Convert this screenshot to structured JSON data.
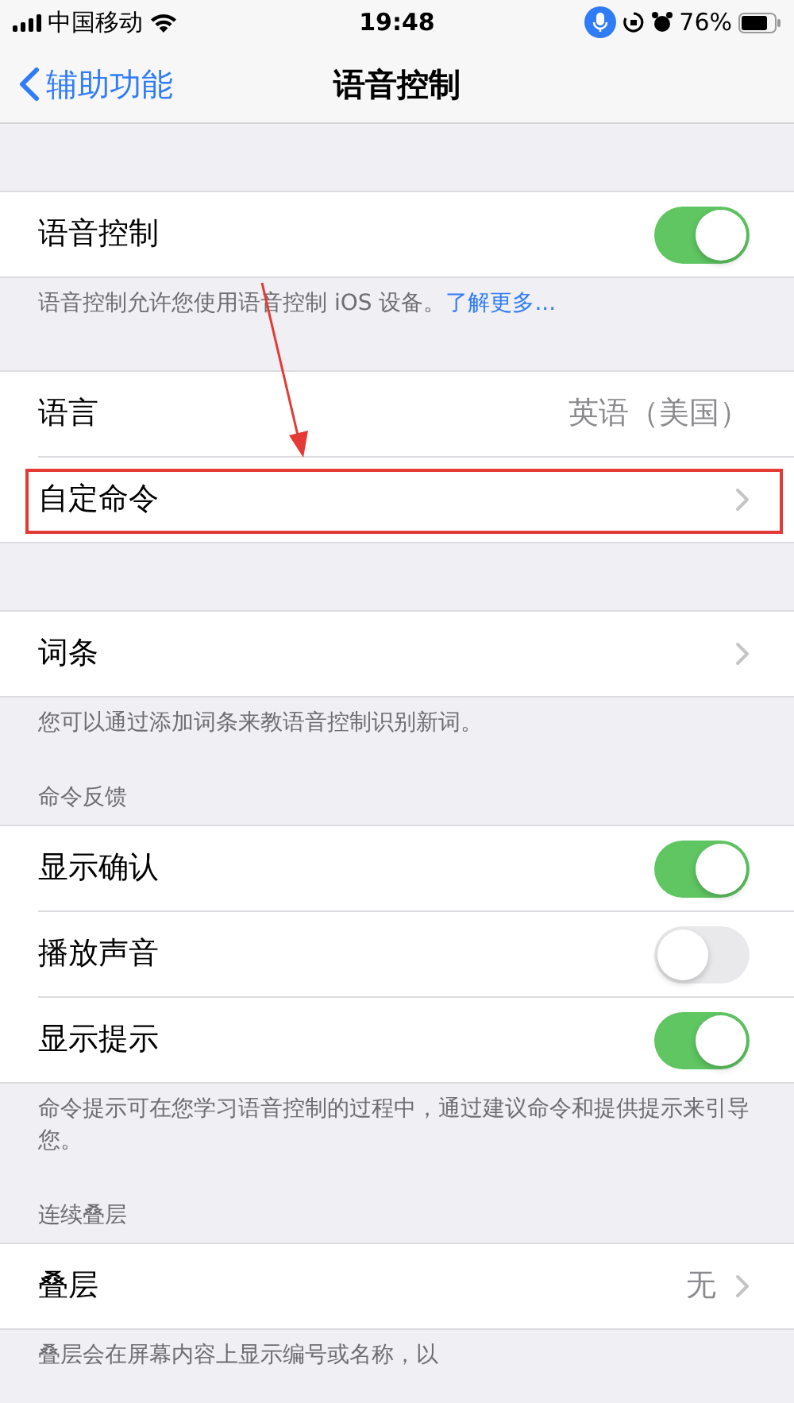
{
  "status_bar": {
    "carrier": "中国移动",
    "time": "19:48",
    "battery": "76%"
  },
  "nav": {
    "back": "辅助功能",
    "title": "语音控制"
  },
  "sections": [
    {
      "rows": [
        {
          "kind": "toggle",
          "label": "语音控制",
          "on": true
        }
      ],
      "footer": "语音控制允许您使用语音控制 iOS 设备。",
      "footer_link": "了解更多..."
    },
    {
      "rows": [
        {
          "kind": "value",
          "label": "语言",
          "value": "英语（美国）"
        },
        {
          "kind": "link",
          "label": "自定命令",
          "highlighted": true
        }
      ]
    },
    {
      "rows": [
        {
          "kind": "link",
          "label": "词条"
        }
      ],
      "footer": "您可以通过添加词条来教语音控制识别新词。"
    },
    {
      "header": "命令反馈",
      "rows": [
        {
          "kind": "toggle",
          "label": "显示确认",
          "on": true
        },
        {
          "kind": "toggle",
          "label": "播放声音",
          "on": false
        },
        {
          "kind": "toggle",
          "label": "显示提示",
          "on": true
        }
      ],
      "footer": "命令提示可在您学习语音控制的过程中，通过建议命令和提供提示来引导您。"
    },
    {
      "header": "连续叠层",
      "rows": [
        {
          "kind": "link",
          "label": "叠层",
          "value": "无"
        }
      ],
      "footer": "叠层会在屏幕内容上显示编号或名称，以"
    }
  ]
}
